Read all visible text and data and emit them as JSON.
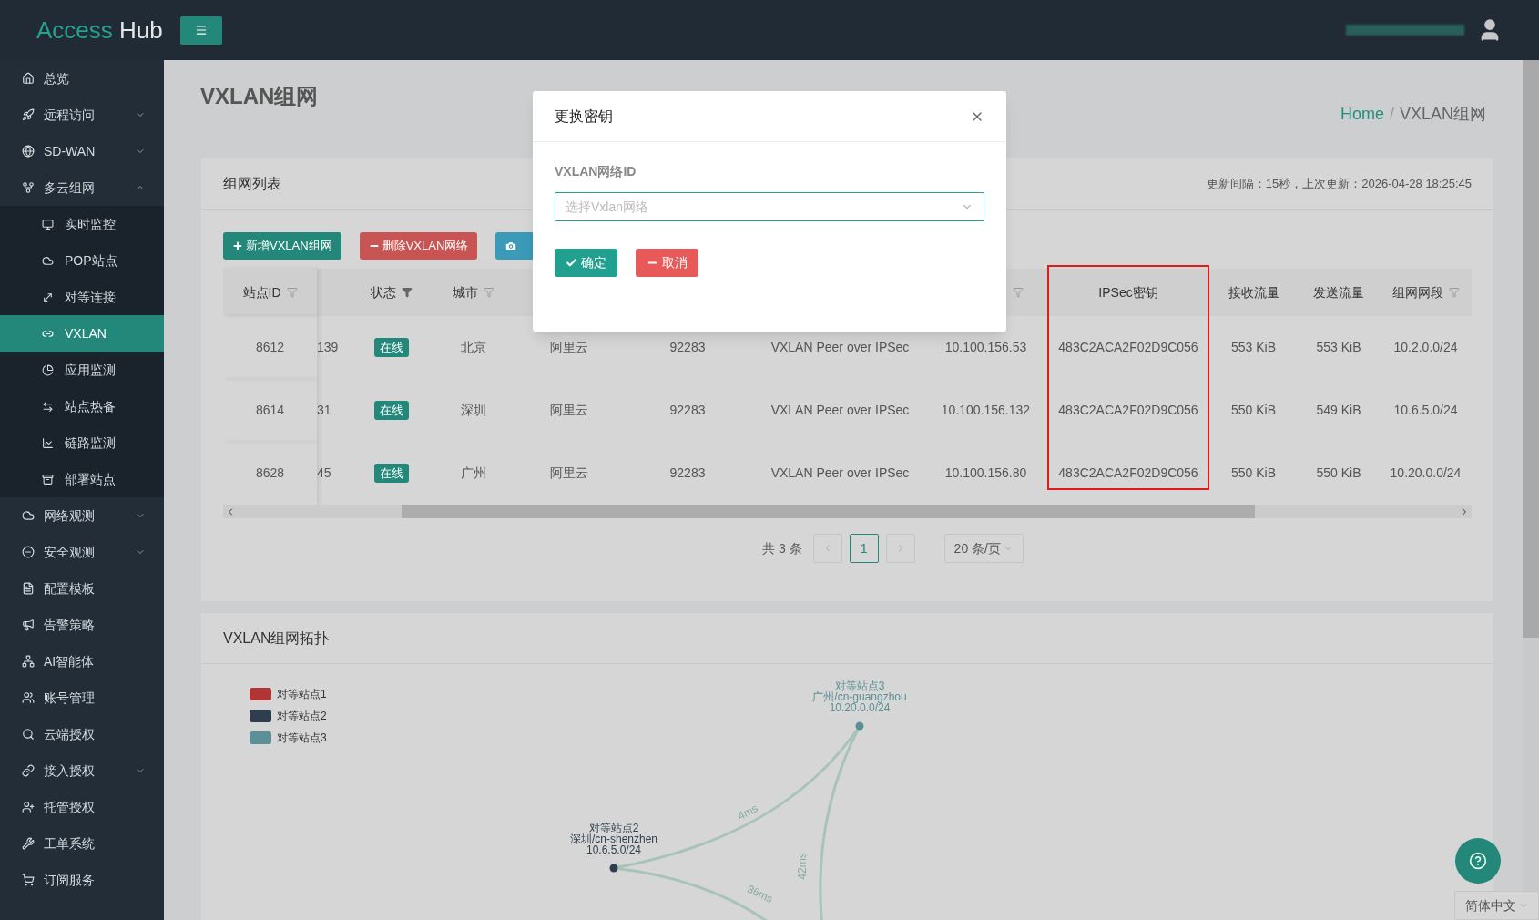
{
  "header": {
    "logo": {
      "first": "Access",
      "second": "Hub"
    }
  },
  "sidebar": {
    "items": [
      {
        "label": "总览",
        "kind": "link",
        "selected": false
      },
      {
        "label": "远程访问",
        "kind": "group",
        "expanded": false,
        "selected": false
      },
      {
        "label": "SD-WAN",
        "kind": "group",
        "expanded": false,
        "selected": false
      },
      {
        "label": "多云组网",
        "kind": "group",
        "expanded": true,
        "selected": false,
        "children": [
          {
            "label": "实时监控",
            "selected": false
          },
          {
            "label": "POP站点",
            "selected": false
          },
          {
            "label": "对等连接",
            "selected": false
          },
          {
            "label": "VXLAN",
            "selected": true
          },
          {
            "label": "应用监测",
            "selected": false
          },
          {
            "label": "站点热备",
            "selected": false
          },
          {
            "label": "链路监测",
            "selected": false
          },
          {
            "label": "部署站点",
            "selected": false
          }
        ]
      },
      {
        "label": "网络观测",
        "kind": "group",
        "expanded": false,
        "selected": false
      },
      {
        "label": "安全观测",
        "kind": "group",
        "expanded": false,
        "selected": false
      },
      {
        "label": "配置模板",
        "kind": "link",
        "selected": false
      },
      {
        "label": "告警策略",
        "kind": "link",
        "selected": false
      },
      {
        "label": "AI智能体",
        "kind": "link",
        "selected": false
      },
      {
        "label": "账号管理",
        "kind": "link",
        "selected": false
      },
      {
        "label": "云端授权",
        "kind": "link",
        "selected": false
      },
      {
        "label": "接入授权",
        "kind": "group",
        "expanded": false,
        "selected": false
      },
      {
        "label": "托管授权",
        "kind": "link",
        "selected": false
      },
      {
        "label": "工单系统",
        "kind": "link",
        "selected": false
      },
      {
        "label": "订阅服务",
        "kind": "link",
        "selected": false
      }
    ]
  },
  "page": {
    "title": "VXLAN组网",
    "breadcrumb": [
      "Home",
      "VXLAN组网"
    ],
    "breadcrumb_separator": "/"
  },
  "list_card": {
    "title": "组网列表",
    "update_info": "更新间隔：15秒，上次更新：2026-04-28 18:25:45",
    "buttons": [
      {
        "label": "新增VXLAN组网",
        "kind": "add"
      },
      {
        "label": "删除VXLAN网络",
        "kind": "delete"
      },
      {
        "kind": "snapshot"
      }
    ],
    "table": {
      "columns": [
        {
          "label": "站点ID",
          "filterable": true,
          "filter_active": false,
          "kind": "text",
          "highlighted": false
        },
        {
          "filterable": false,
          "kind": "text",
          "highlighted": false
        },
        {
          "label": "状态",
          "filterable": true,
          "filter_active": true,
          "kind": "badge",
          "highlighted": false
        },
        {
          "label": "城市",
          "filterable": true,
          "filter_active": false,
          "kind": "text",
          "highlighted": false
        },
        {
          "filterable": false,
          "kind": "text",
          "highlighted": false
        },
        {
          "filterable": false,
          "kind": "text",
          "highlighted": false
        },
        {
          "filterable": false,
          "kind": "text",
          "highlighted": false
        },
        {
          "filterable": true,
          "filter_active": false,
          "kind": "text",
          "highlighted": false
        },
        {
          "label": "IPSec密钥",
          "filterable": false,
          "kind": "text",
          "highlighted": true
        },
        {
          "label": "接收流量",
          "filterable": false,
          "kind": "text",
          "highlighted": false
        },
        {
          "label": "发送流量",
          "filterable": false,
          "kind": "text",
          "highlighted": false
        },
        {
          "label": "组网网段",
          "filterable": true,
          "filter_active": false,
          "kind": "text",
          "highlighted": false
        }
      ],
      "rows": [
        {
          "cells": [
            "8612",
            "139",
            "在线",
            "北京",
            "阿里云",
            "92283",
            "VXLAN Peer over IPSec",
            "10.100.156.53",
            "483C2ACA2F02D9C056",
            "553 KiB",
            "553 KiB",
            "10.2.0.0/24"
          ]
        },
        {
          "cells": [
            "8614",
            "31",
            "在线",
            "深圳",
            "阿里云",
            "92283",
            "VXLAN Peer over IPSec",
            "10.100.156.132",
            "483C2ACA2F02D9C056",
            "550 KiB",
            "549 KiB",
            "10.6.5.0/24"
          ]
        },
        {
          "cells": [
            "8628",
            "45",
            "在线",
            "广州",
            "阿里云",
            "92283",
            "VXLAN Peer over IPSec",
            "10.100.156.80",
            "483C2ACA2F02D9C056",
            "550 KiB",
            "550 KiB",
            "10.20.0.0/24"
          ]
        }
      ]
    },
    "pagination": {
      "total": "共 3 条",
      "pages": [
        {
          "label": "1",
          "selected": true
        }
      ],
      "page_size": "20 条/页"
    }
  },
  "topology_card": {
    "title": "VXLAN组网拓扑",
    "legend": [
      {
        "label": "对等站点1",
        "color": "#b03535"
      },
      {
        "label": "对等站点2",
        "color": "#2f3e4e"
      },
      {
        "label": "对等站点3",
        "color": "#5b9196"
      }
    ],
    "nodes": [
      {
        "name": "对等站点3",
        "location": "广州/cn-guangzhou",
        "subnet": "10.20.0.0/24",
        "color": "#5b9196"
      },
      {
        "name": "对等站点2",
        "location": "深圳/cn-shenzhen",
        "subnet": "10.6.5.0/24",
        "color": "#2f3e4e"
      }
    ],
    "edges": [
      {
        "label": "4ms"
      },
      {
        "label": "42ms"
      },
      {
        "label": "36ms"
      }
    ]
  },
  "modal": {
    "title": "更换密钥",
    "field_label": "VXLAN网络ID",
    "placeholder": "选择Vxlan网络",
    "buttons": [
      {
        "label": "确定",
        "kind": "confirm"
      },
      {
        "label": "取消",
        "kind": "cancel"
      }
    ]
  },
  "language": "简体中文"
}
